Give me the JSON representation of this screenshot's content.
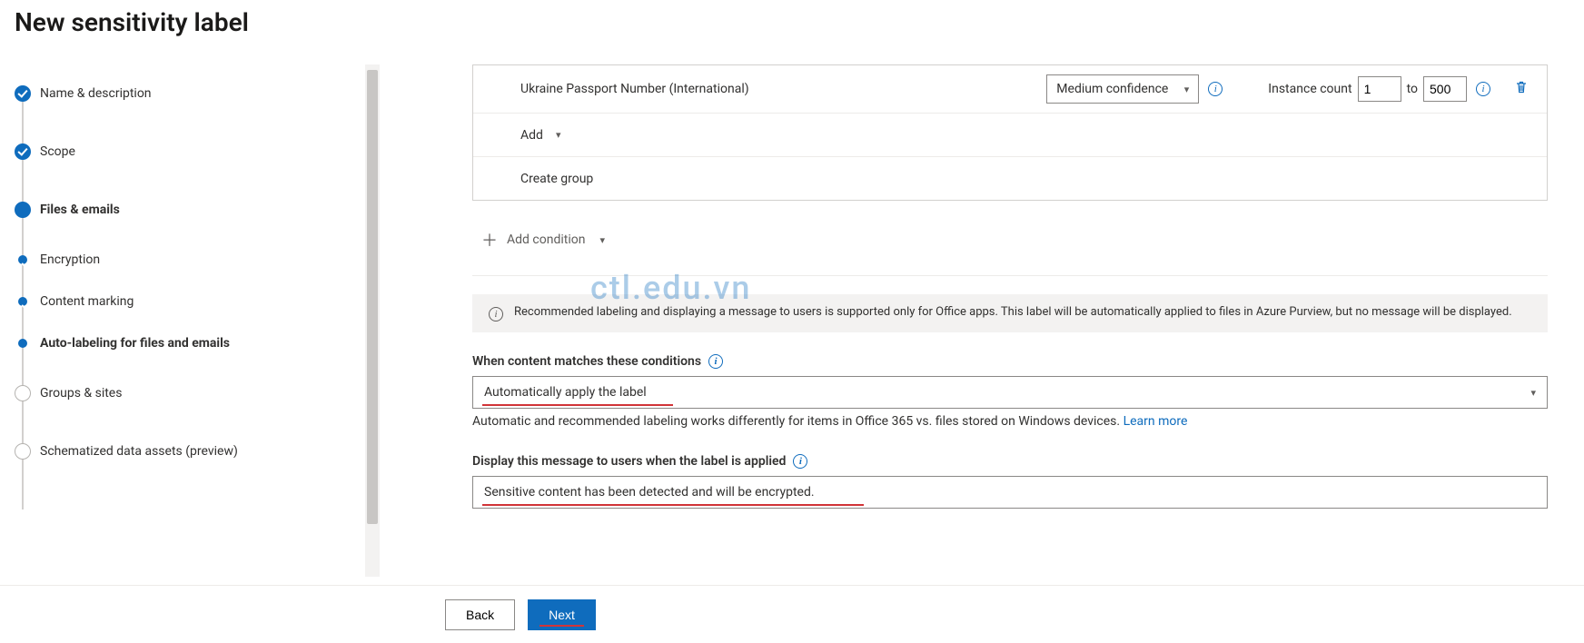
{
  "page": {
    "title": "New sensitivity label"
  },
  "steps": [
    {
      "label": "Name & description",
      "state": "done"
    },
    {
      "label": "Scope",
      "state": "done"
    },
    {
      "label": "Files & emails",
      "state": "active"
    },
    {
      "label": "Encryption",
      "state": "sub-done"
    },
    {
      "label": "Content marking",
      "state": "sub-done"
    },
    {
      "label": "Auto-labeling for files and emails",
      "state": "sub-active"
    },
    {
      "label": "Groups & sites",
      "state": "future"
    },
    {
      "label": "Schematized data assets (preview)",
      "state": "future"
    }
  ],
  "condition": {
    "sit_name": "Ukraine Passport Number (International)",
    "confidence_label": "Medium confidence",
    "instance_label": "Instance count",
    "instance_from": "1",
    "instance_to_label": "to",
    "instance_to": "500",
    "add_label": "Add",
    "create_group_label": "Create group"
  },
  "add_condition_label": "Add condition",
  "banner_text": "Recommended labeling and displaying a message to users is supported only for Office apps. This label will be automatically applied to files in Azure Purview, but no message will be displayed.",
  "match_section": {
    "heading": "When content matches these conditions",
    "select_value": "Automatically apply the label",
    "helper": "Automatic and recommended labeling works differently for items in Office 365 vs. files stored on Windows devices. ",
    "learn_more": "Learn more"
  },
  "message_section": {
    "heading": "Display this message to users when the label is applied",
    "value": "Sensitive content has been detected and will be encrypted."
  },
  "footer": {
    "back": "Back",
    "next": "Next"
  },
  "watermark": "ctl.edu.vn"
}
